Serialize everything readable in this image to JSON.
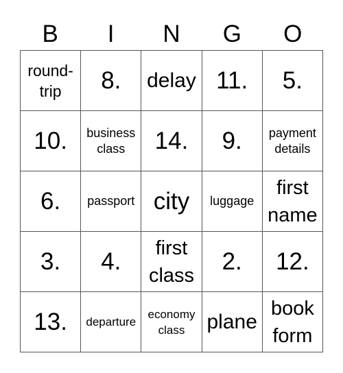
{
  "header": {
    "letters": [
      "B",
      "I",
      "N",
      "G",
      "O"
    ]
  },
  "grid": {
    "rows": [
      [
        {
          "text": "round-\ntrip",
          "size": "ml"
        },
        {
          "text": "8.",
          "size": "num"
        },
        {
          "text": "delay",
          "size": "l"
        },
        {
          "text": "11.",
          "size": "num"
        },
        {
          "text": "5.",
          "size": "num"
        }
      ],
      [
        {
          "text": "10.",
          "size": "num"
        },
        {
          "text": "business\nclass",
          "size": "s"
        },
        {
          "text": "14.",
          "size": "num"
        },
        {
          "text": "9.",
          "size": "num"
        },
        {
          "text": "payment\ndetails",
          "size": "s"
        }
      ],
      [
        {
          "text": "6.",
          "size": "num"
        },
        {
          "text": "passport",
          "size": "s"
        },
        {
          "text": "city",
          "size": "num"
        },
        {
          "text": "luggage",
          "size": "s"
        },
        {
          "text": "first\nname",
          "size": "m"
        }
      ],
      [
        {
          "text": "3.",
          "size": "num"
        },
        {
          "text": "4.",
          "size": "num"
        },
        {
          "text": "first\nclass",
          "size": "m"
        },
        {
          "text": "2.",
          "size": "num"
        },
        {
          "text": "12.",
          "size": "num"
        }
      ],
      [
        {
          "text": "13.",
          "size": "num"
        },
        {
          "text": "departure",
          "size": "xs"
        },
        {
          "text": "economy\nclass",
          "size": "xs"
        },
        {
          "text": "plane",
          "size": "l"
        },
        {
          "text": "book\nform",
          "size": "m"
        }
      ]
    ]
  }
}
